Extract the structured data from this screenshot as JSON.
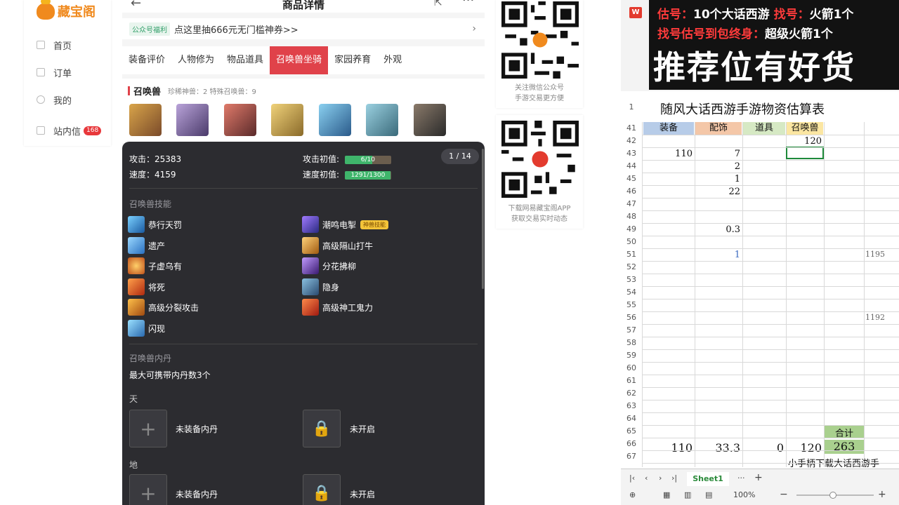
{
  "sidebar": {
    "logo_text": "藏宝阁",
    "items": [
      {
        "label": "首页"
      },
      {
        "label": "订单"
      },
      {
        "label": "我的"
      },
      {
        "label": "站内信",
        "badge": "168"
      }
    ]
  },
  "phone": {
    "title": "商品详情",
    "promo_tag": "公众号福利",
    "promo_text": "点这里抽666元无门槛神券>>",
    "tabs": [
      "装备评价",
      "人物修为",
      "物品道具",
      "召唤兽坐骑",
      "家园养育",
      "外观"
    ],
    "active_tab": "召唤兽坐骑",
    "summon_label": "召唤兽",
    "summon_sub": "珍稀神兽：2   特殊召唤兽：9",
    "pager": "1 / 14",
    "stats": {
      "attack_label": "攻击：25383",
      "speed_label": "速度：4159",
      "attack_init_label": "攻击初值:",
      "attack_init_value": "6/10",
      "attack_init_frac": 0.6,
      "speed_init_label": "速度初值:",
      "speed_init_value": "1291/1300",
      "speed_init_frac": 0.99
    },
    "skills_title": "召唤兽技能",
    "skills": [
      "恭行天罚",
      "潮鸣电掣",
      "遗产",
      "高级隔山打牛",
      "子虚乌有",
      "分花拂柳",
      "将死",
      "隐身",
      "高级分裂攻击",
      "高级神工鬼力",
      "闪现"
    ],
    "skill_badge": "神兽技能",
    "neidan_title": "召唤兽内丹",
    "neidan_desc": "最大可携带内丹数3个",
    "tian_label": "天",
    "di_label": "地",
    "unequipped": "未装备内丹",
    "locked": "未开启"
  },
  "qr": {
    "cap1_line1": "关注微信公众号",
    "cap1_line2": "手游交易更方便",
    "cap2_line1": "下载网易藏宝阁APP",
    "cap2_line2": "获取交易实时动态"
  },
  "banner": {
    "l1_a": "估号：",
    "l1_b": "10个大话西游",
    "l1_c": " 找号：",
    "l1_d": "火箭1个",
    "l2_a": "找号估号到包终身：",
    "l2_b": "超级火箭1个",
    "big": "推荐位有好货"
  },
  "sheet": {
    "wps_label": "W",
    "title": "随风大话西游手游物资估算表",
    "headers": [
      "装备",
      "配饰",
      "道具",
      "召唤兽"
    ],
    "header_colors": [
      "#b7cce8",
      "#f4c7a8",
      "#d6e9c4",
      "#fbe6a2"
    ],
    "rows": [
      "41",
      "42",
      "43",
      "44",
      "45",
      "46",
      "47",
      "48",
      "49",
      "50",
      "51",
      "52",
      "53",
      "54",
      "55",
      "56",
      "57",
      "58",
      "59",
      "60",
      "61",
      "62",
      "63",
      "64",
      "65",
      "66",
      "67"
    ],
    "r42_summon": "120",
    "r43_equip": "110",
    "r43_acc": "7",
    "r44_acc": "2",
    "r45_acc": "1",
    "r46_acc": "22",
    "r49_acc": "0.3",
    "r51_acc": "1",
    "r51_far": "1195",
    "r56_far": "1192",
    "total_label": "合计",
    "tot_equip": "110",
    "tot_acc": "33.3",
    "tot_item": "0",
    "tot_summon": "120",
    "tot_sum": "263",
    "footer_text": "小手柄下载大话西游手",
    "sheet_tab": "Sheet1",
    "zoom": "100%",
    "row1": "1"
  }
}
